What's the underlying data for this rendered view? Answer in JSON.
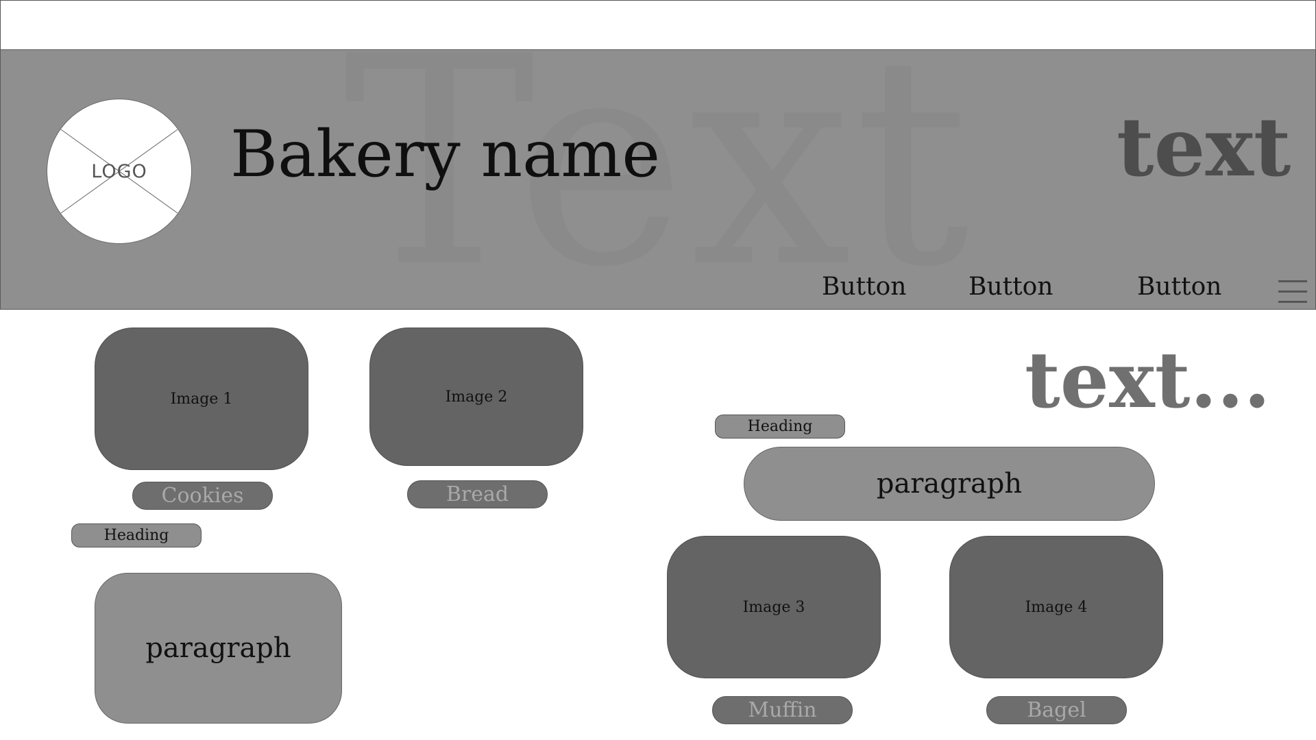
{
  "header": {
    "logo_label": "LOGO",
    "bakery_name": "Bakery name",
    "text": "text",
    "background_text": "Text",
    "nav": [
      "Button",
      "Button",
      "Button"
    ],
    "menu_icon": "hamburger-icon"
  },
  "left": {
    "images": [
      {
        "label": "Image 1",
        "caption": "Cookies"
      },
      {
        "label": "Image 2",
        "caption": "Bread"
      }
    ],
    "heading": "Heading",
    "paragraph": "paragraph"
  },
  "right": {
    "text": "text...",
    "heading": "Heading",
    "paragraph": "paragraph",
    "images": [
      {
        "label": "Image 3",
        "caption": "Muffin"
      },
      {
        "label": "Image 4",
        "caption": "Bagel"
      }
    ]
  },
  "colors": {
    "header_bg": "#8f8f8f",
    "image_bg": "#646464",
    "pill_bg": "#6e6e6e",
    "pill_text": "#a9a9a9"
  }
}
